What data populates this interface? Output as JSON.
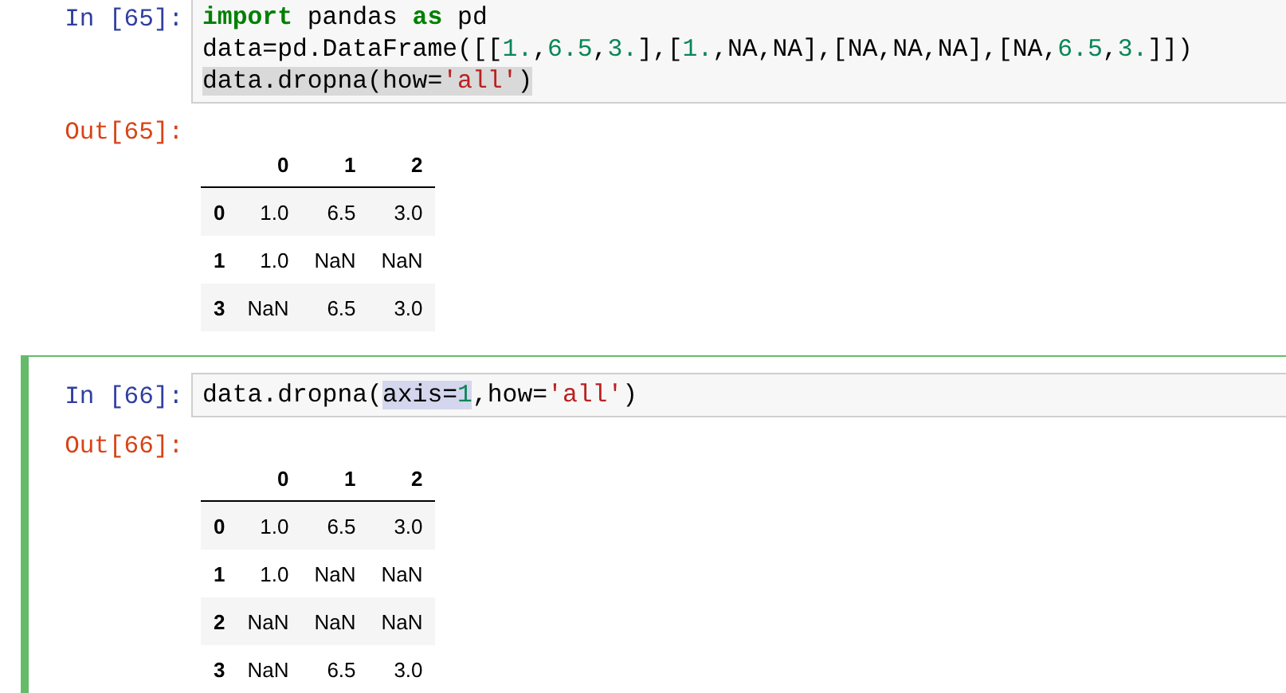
{
  "cells": [
    {
      "selected": false,
      "prompt_in": "In [65]:",
      "code": [
        [
          {
            "text": "import",
            "kind": "keyword"
          },
          {
            "text": " pandas ",
            "kind": "plain"
          },
          {
            "text": "as",
            "kind": "keyword"
          },
          {
            "text": " pd",
            "kind": "plain"
          }
        ],
        [
          {
            "text": "data=pd.DataFrame([[",
            "kind": "plain"
          },
          {
            "text": "1.",
            "kind": "number"
          },
          {
            "text": ",",
            "kind": "plain"
          },
          {
            "text": "6.5",
            "kind": "number"
          },
          {
            "text": ",",
            "kind": "plain"
          },
          {
            "text": "3.",
            "kind": "number"
          },
          {
            "text": "],[",
            "kind": "plain"
          },
          {
            "text": "1.",
            "kind": "number"
          },
          {
            "text": ",NA,NA],[NA,NA,NA],[NA,",
            "kind": "plain"
          },
          {
            "text": "6.5",
            "kind": "number"
          },
          {
            "text": ",",
            "kind": "plain"
          },
          {
            "text": "3.",
            "kind": "number"
          },
          {
            "text": "]])",
            "kind": "plain"
          }
        ],
        [
          {
            "text": "data.dropna(how=",
            "kind": "plain",
            "selected": true
          },
          {
            "text": "'all'",
            "kind": "string",
            "selected": true
          },
          {
            "text": ")",
            "kind": "plain",
            "selected": true
          }
        ]
      ],
      "prompt_out": "Out[65]:",
      "table": {
        "columns": [
          "0",
          "1",
          "2"
        ],
        "rows": [
          {
            "index": "0",
            "cells": [
              "1.0",
              "6.5",
              "3.0"
            ]
          },
          {
            "index": "1",
            "cells": [
              "1.0",
              "NaN",
              "NaN"
            ]
          },
          {
            "index": "3",
            "cells": [
              "NaN",
              "6.5",
              "3.0"
            ]
          }
        ]
      }
    },
    {
      "selected": true,
      "prompt_in": "In [66]:",
      "code": [
        [
          {
            "text": "data.dropna(",
            "kind": "plain"
          },
          {
            "text": "axis=",
            "kind": "plain",
            "matched": true
          },
          {
            "text": "1",
            "kind": "number",
            "matched": true
          },
          {
            "text": ",how=",
            "kind": "plain"
          },
          {
            "text": "'all'",
            "kind": "string"
          },
          {
            "text": ")",
            "kind": "plain"
          }
        ]
      ],
      "prompt_out": "Out[66]:",
      "table": {
        "columns": [
          "0",
          "1",
          "2"
        ],
        "rows": [
          {
            "index": "0",
            "cells": [
              "1.0",
              "6.5",
              "3.0"
            ]
          },
          {
            "index": "1",
            "cells": [
              "1.0",
              "NaN",
              "NaN"
            ]
          },
          {
            "index": "2",
            "cells": [
              "NaN",
              "NaN",
              "NaN"
            ]
          },
          {
            "index": "3",
            "cells": [
              "NaN",
              "6.5",
              "3.0"
            ]
          }
        ]
      }
    }
  ]
}
